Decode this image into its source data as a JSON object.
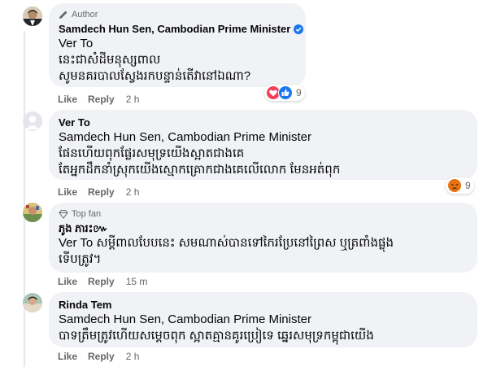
{
  "comments": [
    {
      "badge": "Author",
      "name": "Samdech Hun Sen, Cambodian Prime Minister",
      "lines": [
        "Ver To",
        "នេះជាសំដីមនុស្សពាល",
        "សូមនគរបាលស្វែងរកបន្ទាន់តើវានៅឯណា?"
      ],
      "actions": {
        "like": "Like",
        "reply": "Reply",
        "time": "2 h"
      },
      "reactions": {
        "icons": [
          "love-icon",
          "like-icon"
        ],
        "count": "9"
      }
    },
    {
      "name": "Ver To",
      "lines": [
        "Samdech Hun Sen, Cambodian Prime Minister",
        "ផែនហើយពុកផ្លែរសមុទ្រយើងស្អាតជាងគេ",
        "តែអ្នកដឹកនាំស្រុកយើងស្មោកគ្រោកជាងគេលើលោក មែនអត់ពុក"
      ],
      "actions": {
        "like": "Like",
        "reply": "Reply",
        "time": "2 h"
      },
      "reactions": {
        "icons": [
          "angry-icon"
        ],
        "count": "9"
      }
    },
    {
      "badge": "Top fan",
      "name": "ភូង ភារះ៚",
      "lines": [
        "Ver To សម្ដីពាលបែបនេះ សមណាស់បានទៅកៃរប្រែនៅព្រៃស ឬត្រពាំងផ្លុង",
        "ទើបត្រូវ។"
      ],
      "actions": {
        "like": "Like",
        "reply": "Reply",
        "time": "15 m"
      }
    },
    {
      "name": "Rinda Tem",
      "lines": [
        "Samdech Hun Sen, Cambodian Prime Minister",
        "បាទត្រឹមត្រូវហើយសម្ដេចពុក ស្អាតគ្មានគូរប្រៀទេ ឆ្នេរសមុទ្រកម្ពុជាយើង"
      ],
      "actions": {
        "like": "Like",
        "reply": "Reply",
        "time": "2 h"
      }
    }
  ],
  "colors": {
    "bubble": "#f0f2f5",
    "secondary": "#65676b",
    "verified": "#1877f2",
    "love": "#f33e58",
    "like": "#1877f2",
    "angry": "#e9710f"
  }
}
